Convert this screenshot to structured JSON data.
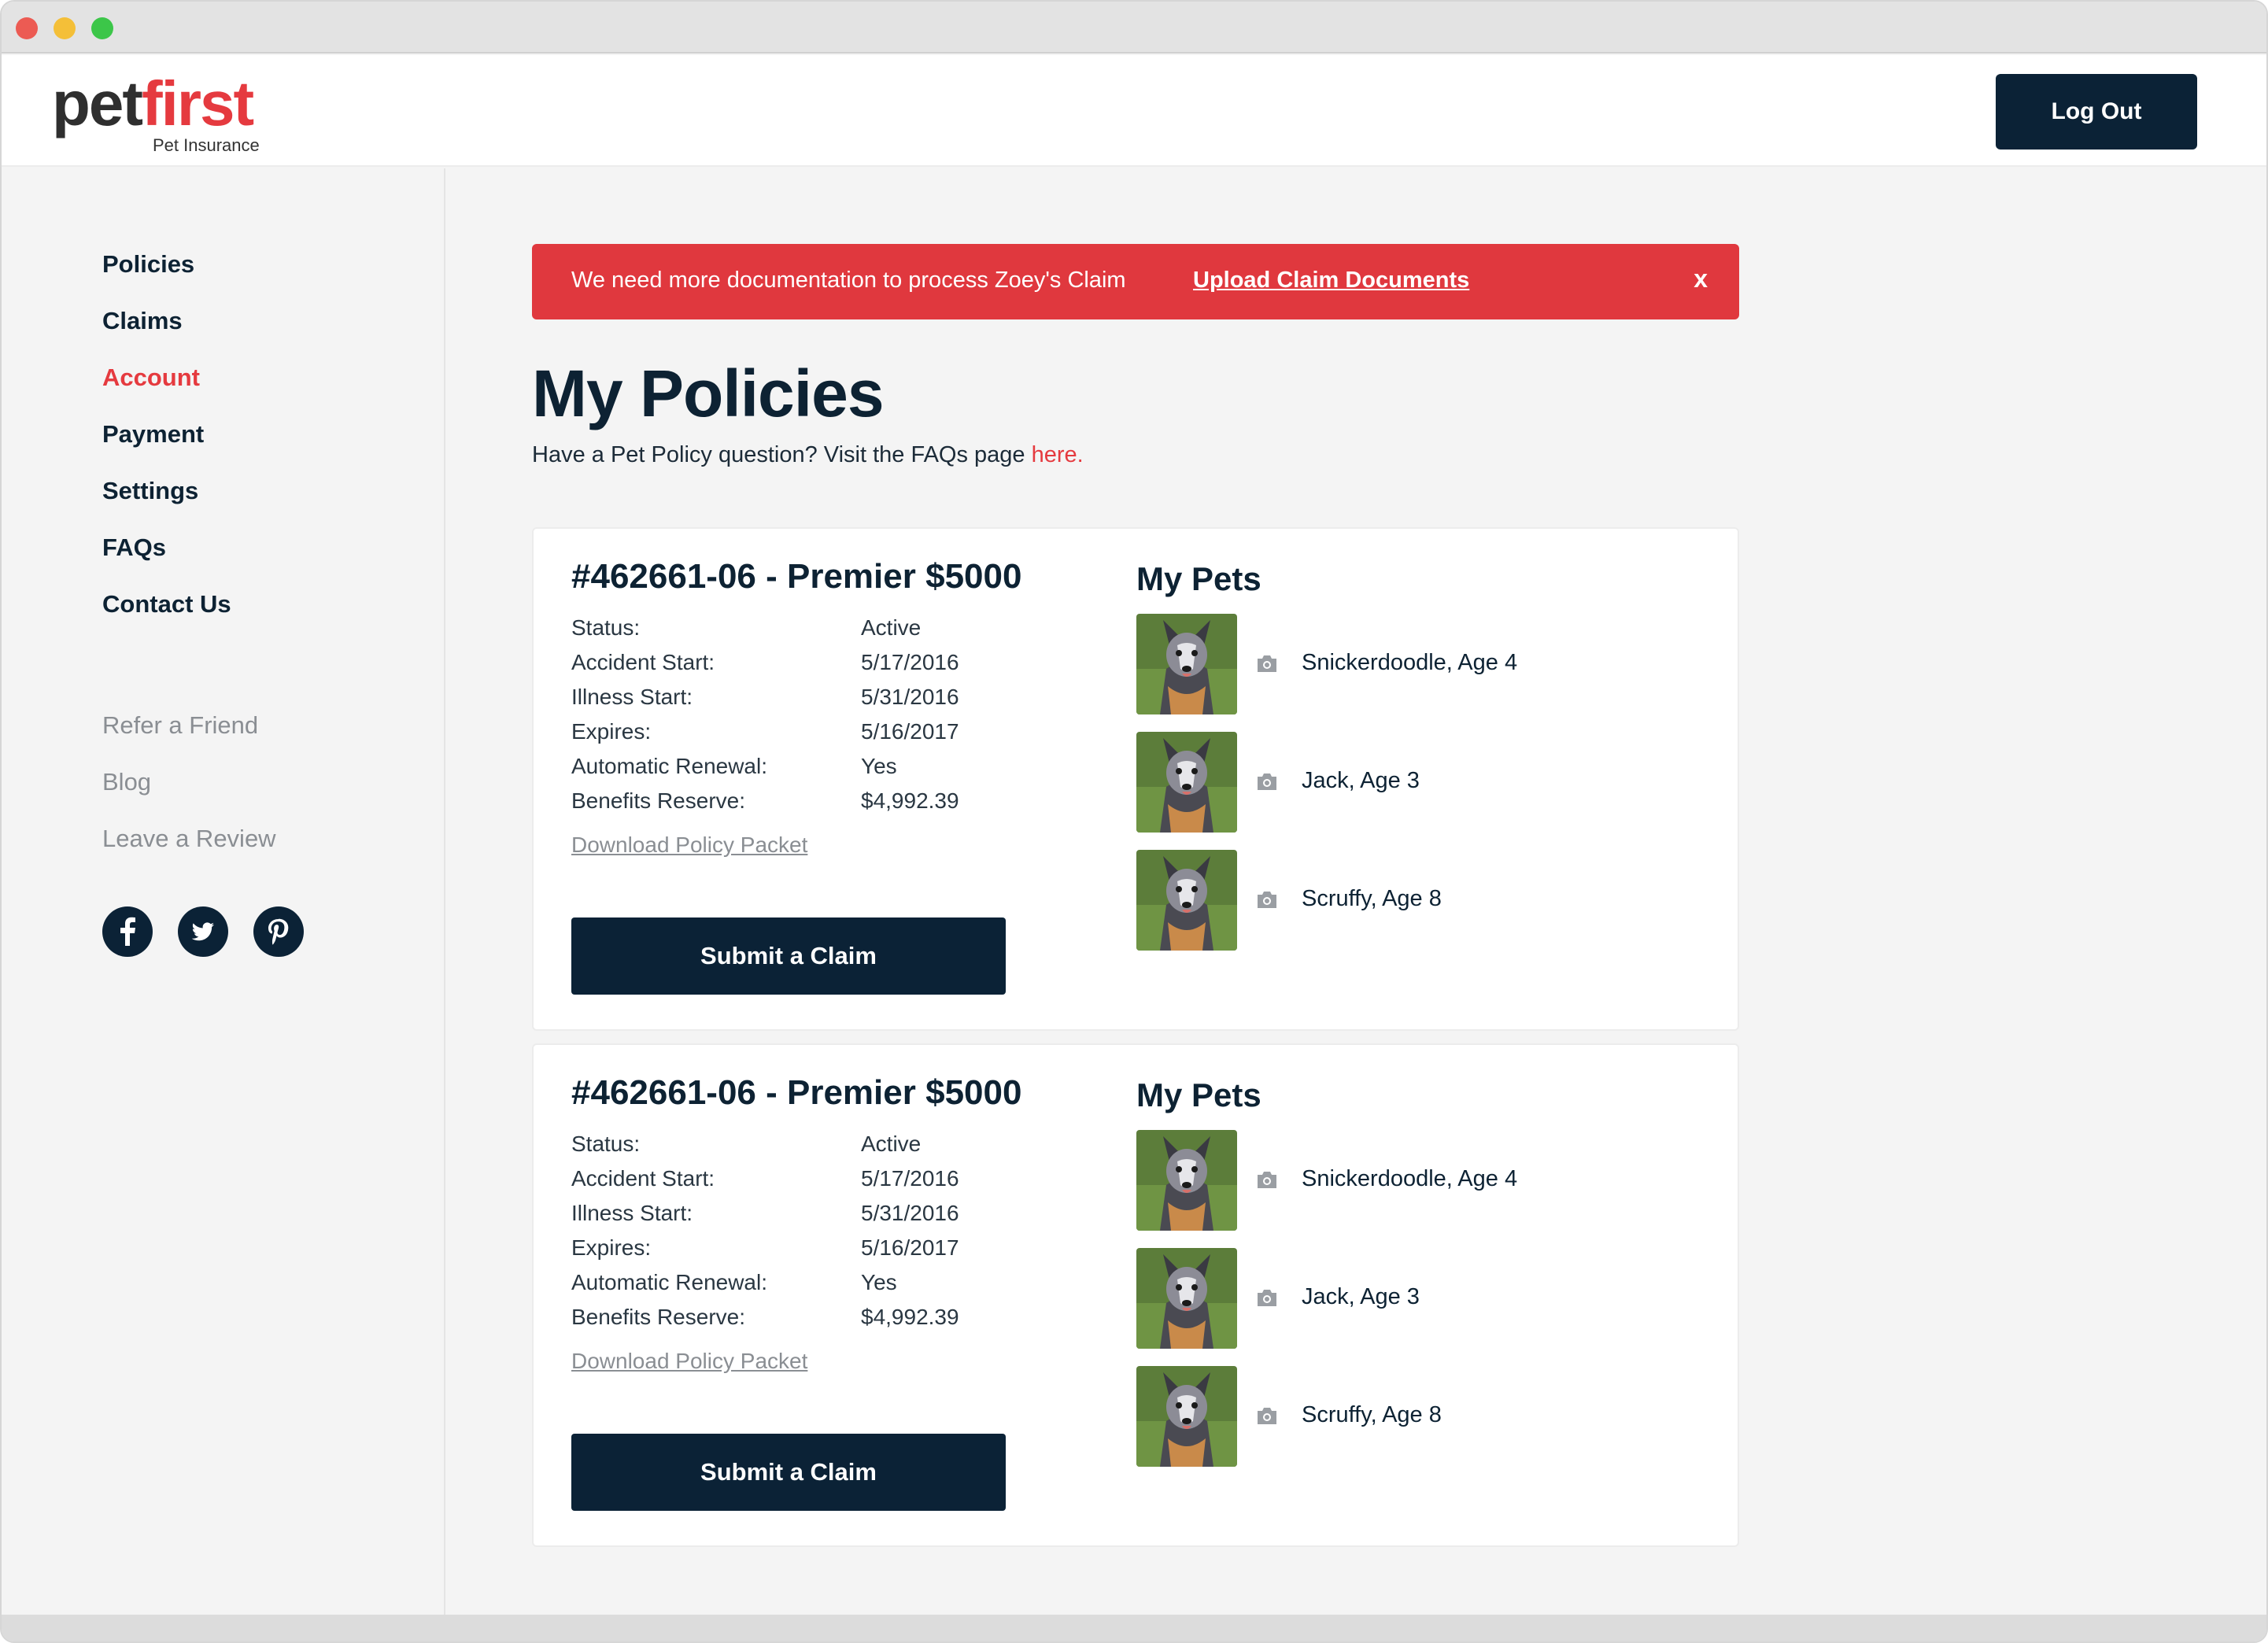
{
  "header": {
    "logo_pet": "pet",
    "logo_first": "first",
    "logo_sub": "Pet Insurance",
    "logout_label": "Log Out"
  },
  "sidebar": {
    "items": [
      {
        "label": "Policies"
      },
      {
        "label": "Claims"
      },
      {
        "label": "Account"
      },
      {
        "label": "Payment"
      },
      {
        "label": "Settings"
      },
      {
        "label": "FAQs"
      },
      {
        "label": "Contact Us"
      }
    ],
    "secondary": [
      {
        "label": "Refer a Friend"
      },
      {
        "label": "Blog"
      },
      {
        "label": "Leave a Review"
      }
    ],
    "social": [
      "facebook-icon",
      "twitter-icon",
      "pinterest-icon"
    ]
  },
  "alert": {
    "message": "We need more documentation to process Zoey's Claim",
    "link": "Upload Claim Documents",
    "close": "x"
  },
  "main": {
    "title": "My Policies",
    "subtitle": "Have a Pet Policy question? Visit the FAQs page ",
    "subtitle_link": "here."
  },
  "policies": [
    {
      "title": "#462661-06 - Premier $5000",
      "rows": [
        {
          "label": "Status:",
          "value": "Active"
        },
        {
          "label": "Accident Start:",
          "value": "5/17/2016"
        },
        {
          "label": "Illness Start:",
          "value": "5/31/2016"
        },
        {
          "label": "Expires:",
          "value": "5/16/2017"
        },
        {
          "label": "Automatic Renewal:",
          "value": "Yes"
        },
        {
          "label": "Benefits Reserve:",
          "value": "$4,992.39"
        }
      ],
      "download": "Download Policy Packet",
      "claim_button": "Submit a Claim",
      "pets_title": "My Pets",
      "pets": [
        {
          "name": "Snickerdoodle, Age 4"
        },
        {
          "name": "Jack, Age 3"
        },
        {
          "name": "Scruffy, Age 8"
        }
      ]
    },
    {
      "title": "#462661-06 - Premier $5000",
      "rows": [
        {
          "label": "Status:",
          "value": "Active"
        },
        {
          "label": "Accident Start:",
          "value": "5/17/2016"
        },
        {
          "label": "Illness Start:",
          "value": "5/31/2016"
        },
        {
          "label": "Expires:",
          "value": "5/16/2017"
        },
        {
          "label": "Automatic Renewal:",
          "value": "Yes"
        },
        {
          "label": "Benefits Reserve:",
          "value": "$4,992.39"
        }
      ],
      "download": "Download Policy Packet",
      "claim_button": "Submit a Claim",
      "pets_title": "My Pets",
      "pets": [
        {
          "name": "Snickerdoodle, Age 4"
        },
        {
          "name": "Jack, Age 3"
        },
        {
          "name": "Scruffy, Age 8"
        }
      ]
    }
  ],
  "colors": {
    "brand_red": "#e53a3f",
    "navy": "#0b2236",
    "alert_red": "#e0383e"
  }
}
